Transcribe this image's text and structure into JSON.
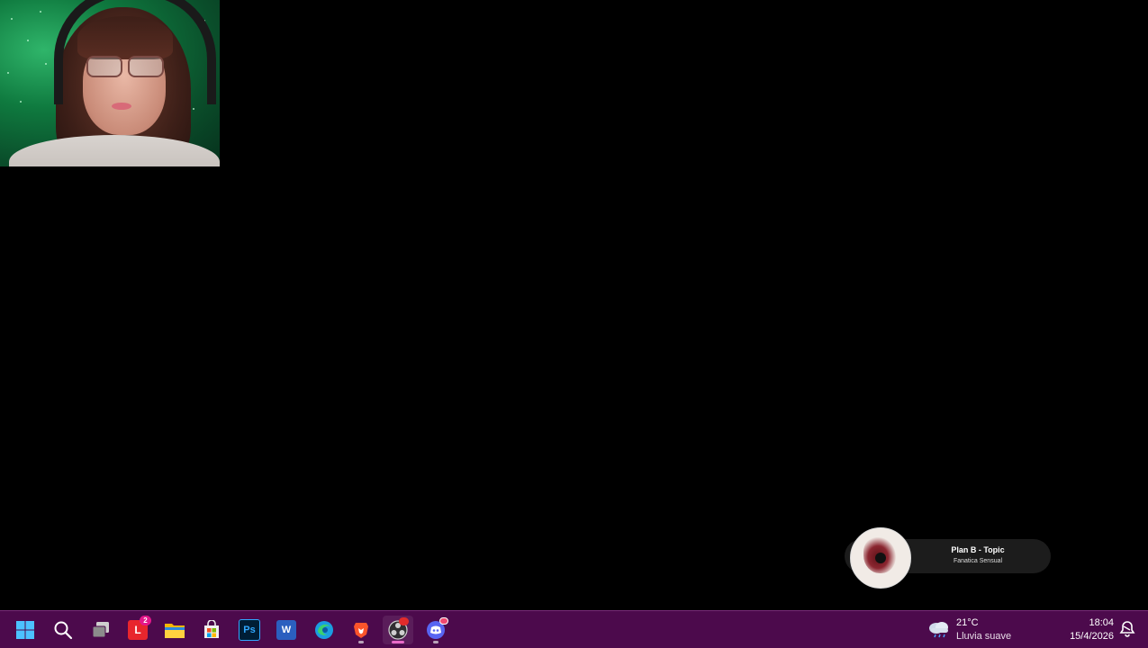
{
  "desktop": {
    "background_color": "#000000"
  },
  "media_widget": {
    "title": "Plan B - Topic",
    "artist": "Fanatica Sensual"
  },
  "taskbar": {
    "background_color": "#4c0a4c",
    "items": [
      {
        "icon": "windows-start-icon",
        "interactable": true
      },
      {
        "icon": "search-icon",
        "interactable": true
      },
      {
        "icon": "task-view-icon",
        "interactable": true
      },
      {
        "icon": "lingq-app-icon",
        "badge": "2"
      },
      {
        "icon": "file-explorer-icon"
      },
      {
        "icon": "microsoft-store-icon"
      },
      {
        "icon": "photoshop-icon",
        "label": "Ps"
      },
      {
        "icon": "word-icon",
        "label": "W"
      },
      {
        "icon": "edge-icon"
      },
      {
        "icon": "brave-icon"
      },
      {
        "icon": "obs-icon"
      },
      {
        "icon": "discord-icon"
      }
    ]
  },
  "tray": {
    "weather": {
      "temperature": "21°C",
      "description": "Lluvia suave",
      "icon": "cloud-rain-icon"
    },
    "clock": {
      "time": "18:04",
      "date": "15/4/2026"
    },
    "notification_icon": "notification-bell-icon"
  }
}
